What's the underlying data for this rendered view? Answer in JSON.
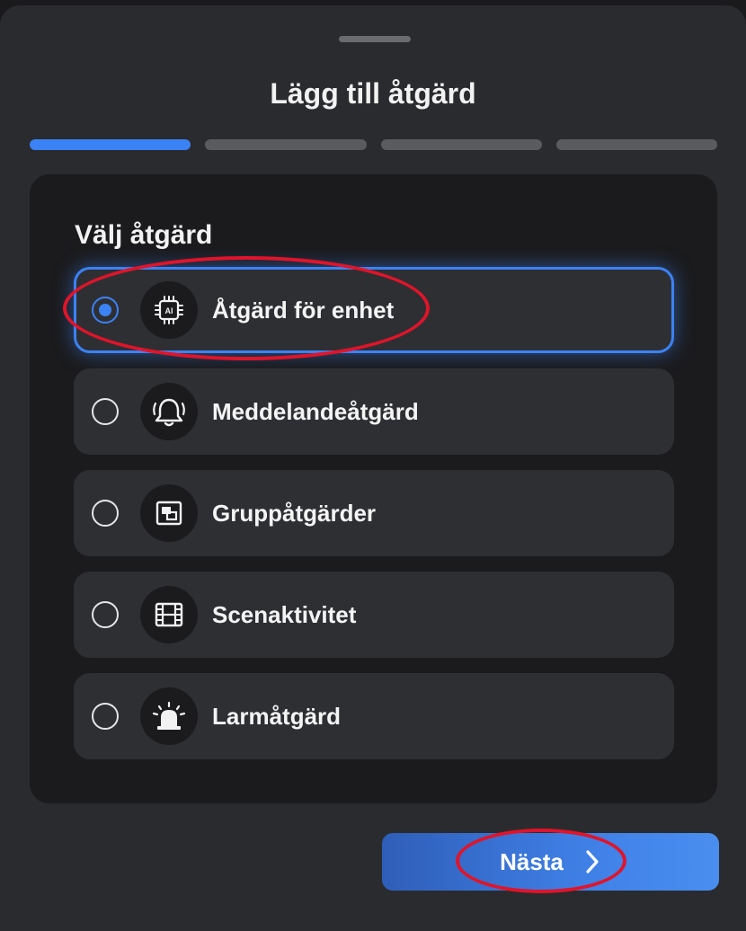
{
  "title": "Lägg till åtgärd",
  "steps": [
    {
      "active": true
    },
    {
      "active": false
    },
    {
      "active": false
    },
    {
      "active": false
    }
  ],
  "section_title": "Välj åtgärd",
  "options": [
    {
      "label": "Åtgärd för enhet",
      "icon": "ai-chip-icon",
      "selected": true
    },
    {
      "label": "Meddelandeåtgärd",
      "icon": "bell-icon",
      "selected": false
    },
    {
      "label": "Gruppåtgärder",
      "icon": "group-icon",
      "selected": false
    },
    {
      "label": "Scenaktivitet",
      "icon": "film-icon",
      "selected": false
    },
    {
      "label": "Larmåtgärd",
      "icon": "alarm-siren-icon",
      "selected": false
    }
  ],
  "next_button": {
    "label": "Nästa",
    "icon": "chevron-right-icon"
  },
  "colors": {
    "accent": "#3b82f6",
    "annotation": "#e0142a",
    "sheet": "#2a2b2e",
    "panel": "#1b1b1d"
  }
}
